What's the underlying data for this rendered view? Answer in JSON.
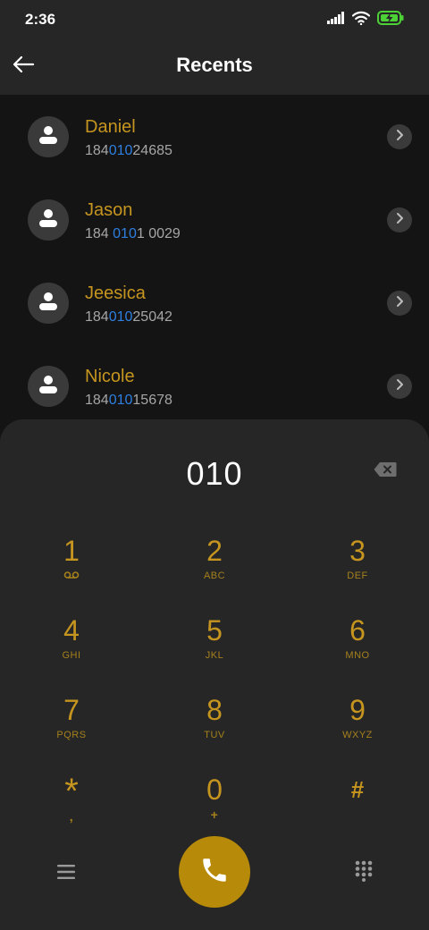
{
  "status": {
    "time": "2:36"
  },
  "header": {
    "title": "Recents"
  },
  "recents": [
    {
      "name": "Daniel",
      "number_pre": "184",
      "number_match": "010",
      "number_post": "24685"
    },
    {
      "name": "Jason",
      "number_pre": "184 ",
      "number_match": "010",
      "number_post": "1 0029"
    },
    {
      "name": "Jeesica",
      "number_pre": "184",
      "number_match": "010",
      "number_post": "25042"
    },
    {
      "name": "Nicole",
      "number_pre": "184",
      "number_match": "010",
      "number_post": "15678"
    }
  ],
  "dialer": {
    "input_value": "010",
    "keys": [
      {
        "digit": "1",
        "letters": ""
      },
      {
        "digit": "2",
        "letters": "ABC"
      },
      {
        "digit": "3",
        "letters": "DEF"
      },
      {
        "digit": "4",
        "letters": "GHI"
      },
      {
        "digit": "5",
        "letters": "JKL"
      },
      {
        "digit": "6",
        "letters": "MNO"
      },
      {
        "digit": "7",
        "letters": "PQRS"
      },
      {
        "digit": "8",
        "letters": "TUV"
      },
      {
        "digit": "9",
        "letters": "WXYZ"
      },
      {
        "digit": "*",
        "letters": ","
      },
      {
        "digit": "0",
        "letters": "+"
      },
      {
        "digit": "#",
        "letters": ""
      }
    ]
  },
  "icons": {
    "signal": "signal-icon",
    "wifi": "wifi-icon",
    "battery": "battery-charging-icon",
    "back": "back-arrow-icon",
    "contact": "person-icon",
    "chevron": "chevron-right-icon",
    "backspace": "backspace-icon",
    "voicemail": "voicemail-icon",
    "menu": "menu-icon",
    "call": "phone-icon",
    "keypad": "dialpad-icon"
  },
  "colors": {
    "accent": "#c6951f",
    "match_highlight": "#2e7fe0",
    "call_button": "#b88a09",
    "battery": "#4cd137"
  }
}
